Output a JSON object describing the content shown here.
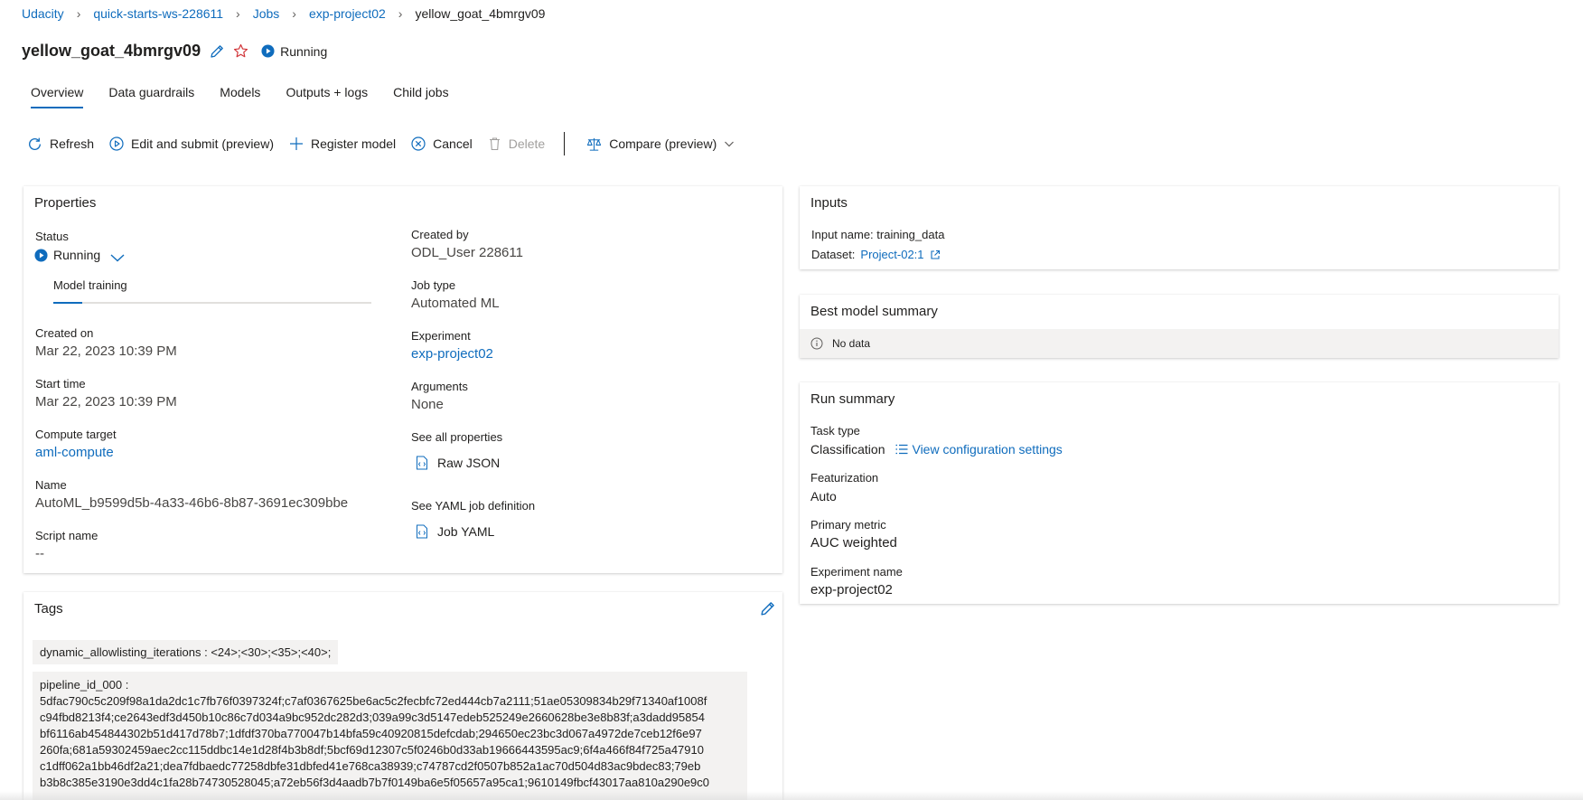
{
  "breadcrumb": {
    "items": [
      "Udacity",
      "quick-starts-ws-228611",
      "Jobs",
      "exp-project02"
    ],
    "current": "yellow_goat_4bmrgv09"
  },
  "header": {
    "title": "yellow_goat_4bmrgv09",
    "status": "Running"
  },
  "tabs": [
    "Overview",
    "Data guardrails",
    "Models",
    "Outputs + logs",
    "Child jobs"
  ],
  "toolbar": {
    "refresh": "Refresh",
    "edit_submit": "Edit and submit (preview)",
    "register_model": "Register model",
    "cancel": "Cancel",
    "delete": "Delete",
    "compare": "Compare (preview)"
  },
  "properties": {
    "title": "Properties",
    "status_label": "Status",
    "status_value": "Running",
    "progress_step": "Model training",
    "progress_fraction": 0.09,
    "created_on_label": "Created on",
    "created_on_value": "Mar 22, 2023 10:39 PM",
    "start_time_label": "Start time",
    "start_time_value": "Mar 22, 2023 10:39 PM",
    "compute_target_label": "Compute target",
    "compute_target_value": "aml-compute",
    "name_label": "Name",
    "name_value": "AutoML_b9599d5b-4a33-46b6-8b87-3691ec309bbe",
    "script_name_label": "Script name",
    "script_name_value": "--",
    "created_by_label": "Created by",
    "created_by_value": "ODL_User 228611",
    "job_type_label": "Job type",
    "job_type_value": "Automated ML",
    "experiment_label": "Experiment",
    "experiment_value": "exp-project02",
    "arguments_label": "Arguments",
    "arguments_value": "None",
    "see_all_label": "See all properties",
    "raw_json": "Raw JSON",
    "see_yaml_label": "See YAML job definition",
    "job_yaml": "Job YAML"
  },
  "inputs": {
    "title": "Inputs",
    "input_name": "Input name: training_data",
    "dataset_label": "Dataset:",
    "dataset_value": "Project-02:1"
  },
  "best_model": {
    "title": "Best model summary",
    "empty": "No data"
  },
  "run_summary": {
    "title": "Run summary",
    "task_type_label": "Task type",
    "task_type_value": "Classification",
    "view_config": "View configuration settings",
    "featurization_label": "Featurization",
    "featurization_value": "Auto",
    "primary_metric_label": "Primary metric",
    "primary_metric_value": "AUC weighted",
    "experiment_name_label": "Experiment name",
    "experiment_name_value": "exp-project02"
  },
  "tags": {
    "title": "Tags",
    "pill": "dynamic_allowlisting_iterations : <24>;<30>;<35>;<40>;",
    "pipeline_key": "pipeline_id_000 :",
    "pipeline_lines": [
      "5dfac790c5c209f98a1da2dc1c7fb76f0397324f;c7af0367625be6ac5c2fecbfc72ed444cb7a2111;51ae05309834b29f71340af1008f",
      "c94fbd8213f4;ce2643edf3d450b10c86c7d034a9bc952dc282d3;039a99c3d5147edeb525249e2660628be3e8b83f;a3dadd95854",
      "bf6116ab454844302b51d417d78b7;1dfdf370ba770047b14bfa59c40920815defcdab;294650ec23bc3d067a4972de7ceb12f6e97",
      "260fa;681a59302459aec2cc115ddbc14e1d28f4b3b8df;5bcf69d12307c5f0246b0d33ab19666443595ac9;6f4a466f84f725a47910",
      "c1dff062a1bb46df2a21;dea7fdbaedc77258dbfe31dbfed41e768ca38939;c74787cd2f0507b852a1ac70d504d83ac9bdec83;79eb",
      "b3b8c385e3190e3dd4c1fa28b74730528045;a72eb56f3d4aadb7b7f0149ba6e5f05657a95ca1;9610149fbcf43017aa810a290e9c0"
    ]
  },
  "colors": {
    "accent": "#0f6cbd",
    "text": "#201f1e",
    "muted": "#605e5c"
  }
}
